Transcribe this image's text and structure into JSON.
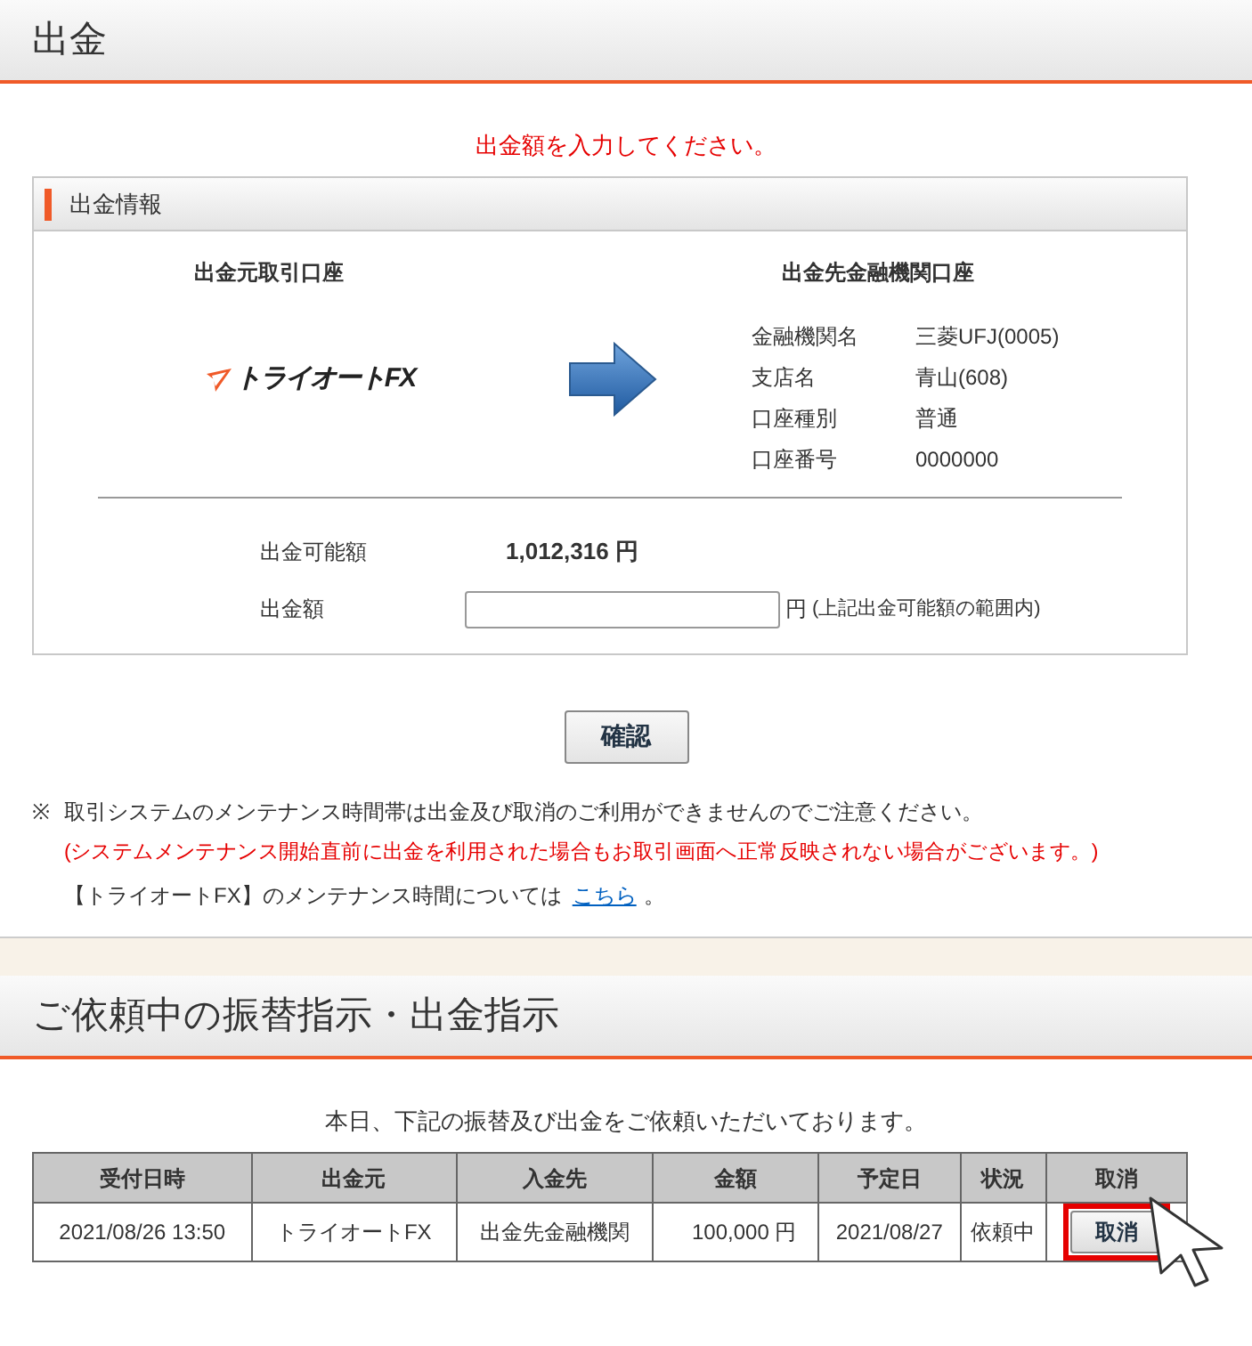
{
  "page_title": "出金",
  "prompt": "出金額を入力してください。",
  "info_panel": {
    "title": "出金情報",
    "source": {
      "heading": "出金元取引口座",
      "logo": "トライオートFX"
    },
    "destination": {
      "heading": "出金先金融機関口座",
      "fields": [
        {
          "label": "金融機関名",
          "value": "三菱UFJ(0005)"
        },
        {
          "label": "支店名",
          "value": "青山(608)"
        },
        {
          "label": "口座種別",
          "value": "普通"
        },
        {
          "label": "口座番号",
          "value": "0000000"
        }
      ]
    },
    "available": {
      "label": "出金可能額",
      "value": "1,012,316 円"
    },
    "amount": {
      "label": "出金額",
      "unit": "円",
      "hint": "(上記出金可能額の範囲内)"
    }
  },
  "confirm_button": "確認",
  "notes": {
    "mark": "※",
    "line1": "取引システムのメンテナンス時間帯は出金及び取消のご利用ができませんのでご注意ください。",
    "line2": "(システムメンテナンス開始直前に出金を利用された場合もお取引画面へ正常反映されない場合がございます。)",
    "line3": "【トライオートFX】のメンテナンス時間については",
    "link": "こちら",
    "line3_end": "。"
  },
  "requests": {
    "title": "ご依頼中の振替指示・出金指示",
    "message": "本日、下記の振替及び出金をご依頼いただいております。",
    "table": {
      "columns": [
        "受付日時",
        "出金元",
        "入金先",
        "金額",
        "予定日",
        "状況",
        "取消"
      ],
      "rows": [
        {
          "cells": [
            "2021/08/26 13:50",
            "トライオートFX",
            "出金先金融機関",
            "100,000 円",
            "2021/08/27",
            "依頼中"
          ],
          "cancel": "取消",
          "highlighted": true
        }
      ]
    }
  }
}
